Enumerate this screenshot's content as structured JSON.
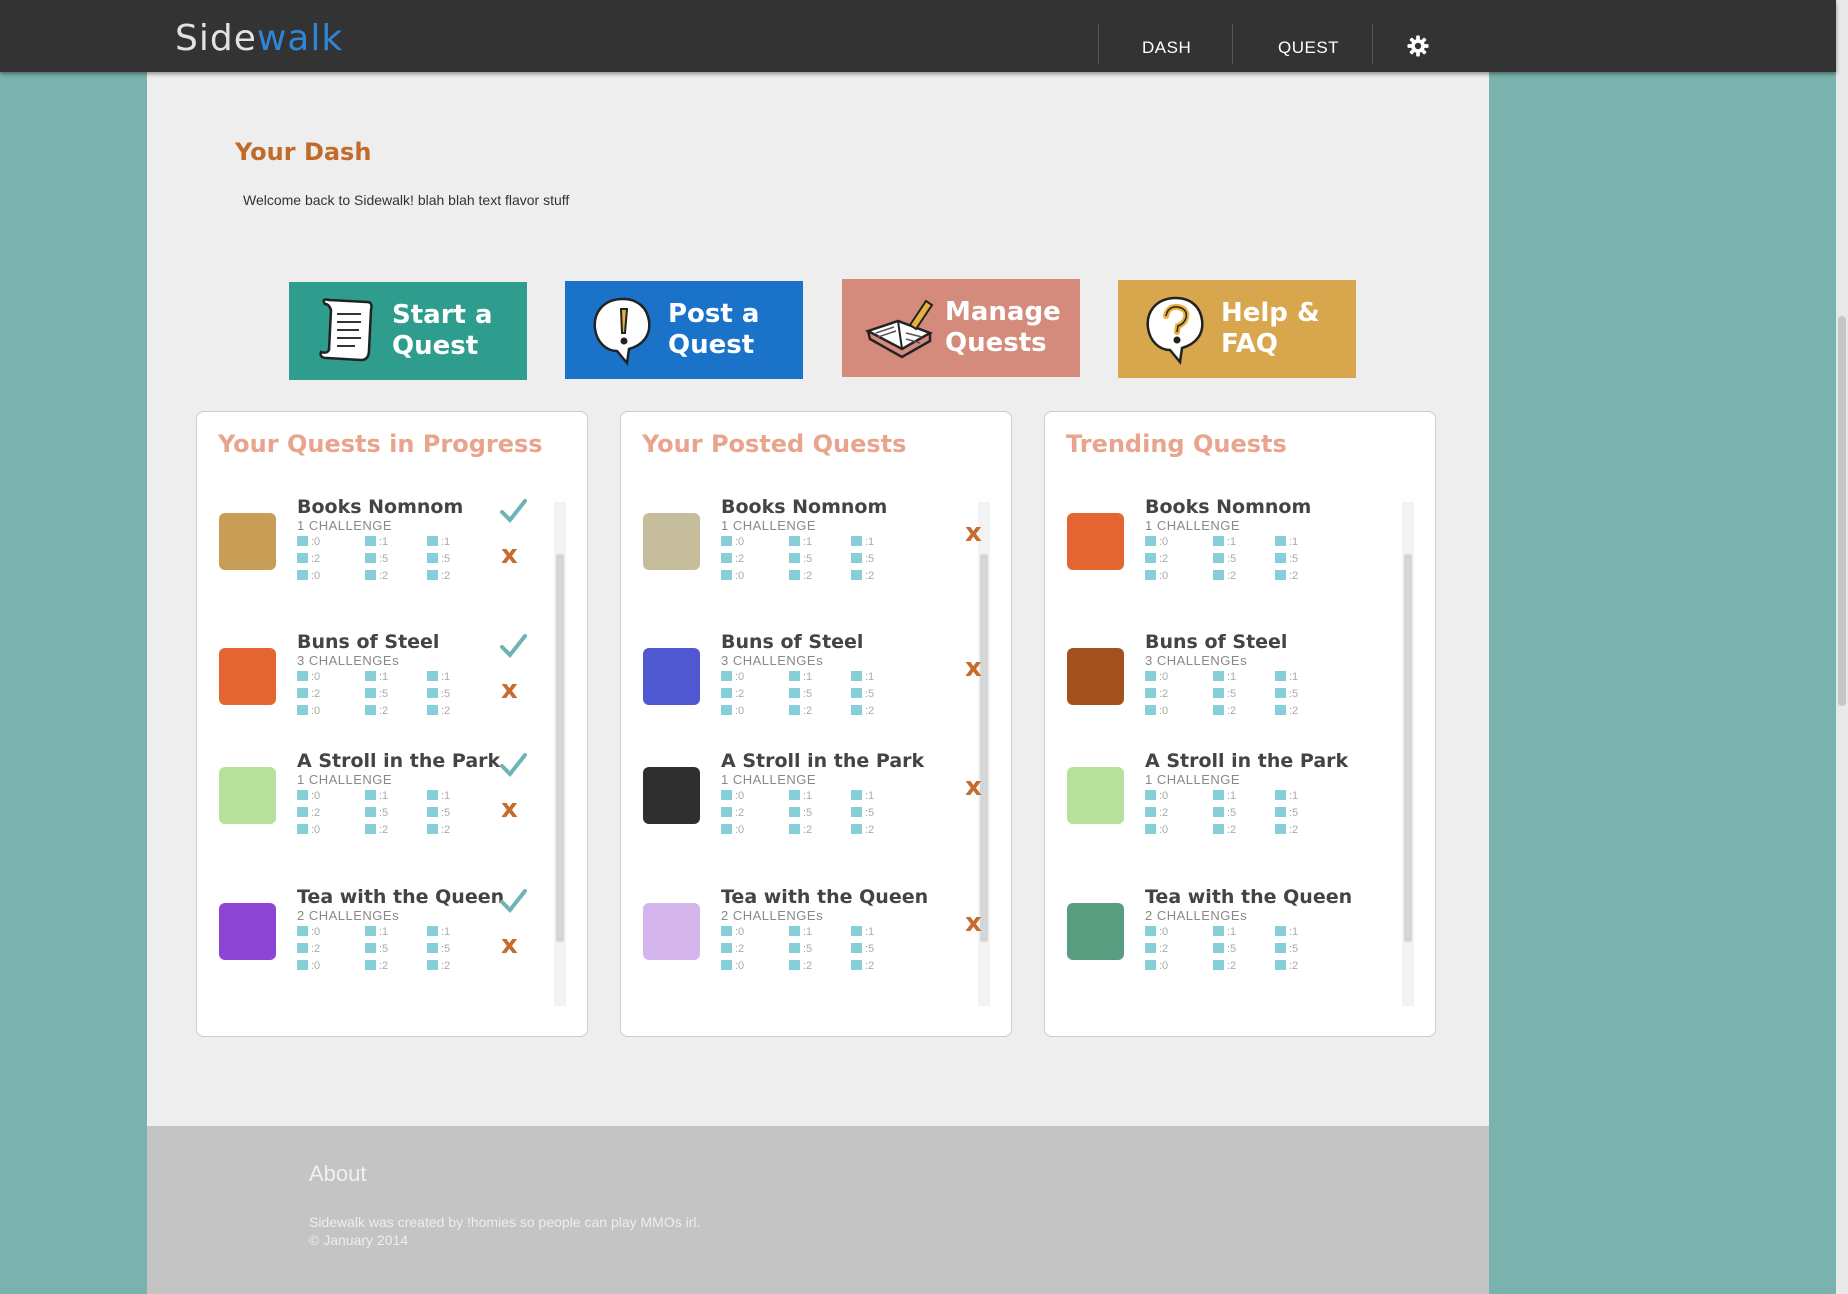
{
  "header": {
    "logo_a": "Side",
    "logo_b": "walk",
    "nav": [
      "DASH",
      "QUEST"
    ]
  },
  "dash": {
    "title": "Your Dash",
    "welcome": "Welcome back to Sidewalk! blah blah text flavor stuff"
  },
  "actions": [
    {
      "line1": "Start a",
      "line2": "Quest",
      "color": "#2e9d8d",
      "icon": "scroll-icon"
    },
    {
      "line1": "Post a",
      "line2": "Quest",
      "color": "#1a73c9",
      "icon": "exclamation-bubble-icon"
    },
    {
      "line1": "Manage",
      "line2": "Quests",
      "color": "#d58b7c",
      "icon": "book-pencil-icon"
    },
    {
      "line1": "Help &",
      "line2": "FAQ",
      "color": "#d7a64d",
      "icon": "question-bubble-icon"
    }
  ],
  "stats_labels": [
    ":0",
    ":1",
    ":1",
    ":2",
    ":5",
    ":5",
    ":0",
    ":2",
    ":2"
  ],
  "panels": [
    {
      "title": "Your Quests in Progress",
      "quests": [
        {
          "title": "Books Nomnom",
          "sub": "1 CHALLENGE",
          "color": "#c89d55"
        },
        {
          "title": "Buns of Steel",
          "sub": "3 CHALLENGEs",
          "color": "#e46432"
        },
        {
          "title": "A Stroll in the Park",
          "sub": "1 CHALLENGE",
          "color": "#b6e09c"
        },
        {
          "title": "Tea with the Queen",
          "sub": "2 CHALLENGEs",
          "color": "#8c45d4"
        }
      ]
    },
    {
      "title": "Your Posted Quests",
      "quests": [
        {
          "title": "Books Nomnom",
          "sub": "1 CHALLENGE",
          "color": "#c6bd9c"
        },
        {
          "title": "Buns of Steel",
          "sub": "3 CHALLENGEs",
          "color": "#4f57d1"
        },
        {
          "title": "A Stroll in the Park",
          "sub": "1 CHALLENGE",
          "color": "#2f2f2f"
        },
        {
          "title": "Tea with the Queen",
          "sub": "2 CHALLENGEs",
          "color": "#d4b6ec"
        }
      ]
    },
    {
      "title": "Trending Quests",
      "quests": [
        {
          "title": "Books Nomnom",
          "sub": "1 CHALLENGE",
          "color": "#e46432"
        },
        {
          "title": "Buns of Steel",
          "sub": "3 CHALLENGEs",
          "color": "#a45120"
        },
        {
          "title": "A Stroll in the Park",
          "sub": "1 CHALLENGE",
          "color": "#b6e09c"
        },
        {
          "title": "Tea with the Queen",
          "sub": "2 CHALLENGEs",
          "color": "#5a9e82"
        }
      ]
    }
  ],
  "footer": {
    "title": "About",
    "line1": "Sidewalk was created by !homies so people can play MMOs irl.",
    "line2": "© January 2014"
  }
}
